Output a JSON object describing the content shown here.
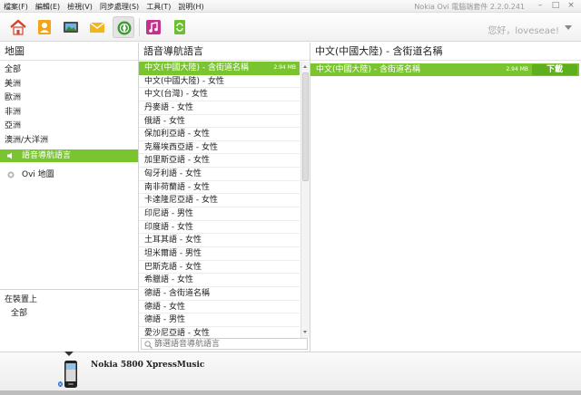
{
  "window": {
    "title": "Nokia Ovi 電腦端套件 2.2.0.241",
    "menus": [
      "檔案(F)",
      "編輯(E)",
      "檢視(V)",
      "同步處理(S)",
      "工具(T)",
      "說明(H)"
    ],
    "controls": [
      "–",
      "□",
      "×"
    ]
  },
  "toolbar": {
    "greeting": "您好，loveseae!",
    "buttons": [
      "home",
      "contacts",
      "photos",
      "messages",
      "maps",
      "music",
      "sync"
    ]
  },
  "left": {
    "header": "地圖",
    "regions": [
      "全部",
      "美洲",
      "歐洲",
      "非洲",
      "亞洲",
      "澳洲/大洋洲"
    ],
    "nav": [
      {
        "label": "語音導航語言",
        "selected": true
      },
      {
        "label": "Ovi 地圖",
        "selected": false
      }
    ],
    "device_section": {
      "header": "在裝置上",
      "item": "全部"
    }
  },
  "middle": {
    "header": "語音導航語言",
    "items": [
      {
        "label": "中文(中國大陸) - 含街道名稱",
        "size": "2.94 MB",
        "selected": true
      },
      {
        "label": "中文(中國大陸) - 女性"
      },
      {
        "label": "中文(台灣) - 女性"
      },
      {
        "label": "丹麥語 - 女性"
      },
      {
        "label": "俄語 - 女性"
      },
      {
        "label": "保加利亞語 - 女性"
      },
      {
        "label": "克羅埃西亞語 - 女性"
      },
      {
        "label": "加里斯亞語 - 女性"
      },
      {
        "label": "匈牙利語 - 女性"
      },
      {
        "label": "南非荷蘭語 - 女性"
      },
      {
        "label": "卡達隆尼亞語 - 女性"
      },
      {
        "label": "印尼語 - 男性"
      },
      {
        "label": "印度語 - 女性"
      },
      {
        "label": "土耳其語 - 女性"
      },
      {
        "label": "坦米爾語 - 男性"
      },
      {
        "label": "巴斯克語 - 女性"
      },
      {
        "label": "希臘語 - 女性"
      },
      {
        "label": "德語 - 含街道名稱"
      },
      {
        "label": "德語 - 女性"
      },
      {
        "label": "德語 - 男性"
      },
      {
        "label": "愛沙尼亞語 - 女性"
      }
    ],
    "search_placeholder": "篩選語音導航語言"
  },
  "right": {
    "header": "中文(中國大陸) - 含街道名稱",
    "item": {
      "label": "中文(中國大陸) - 含街道名稱",
      "size": "2.94 MB",
      "action": "下載"
    }
  },
  "device": {
    "name": "Nokia 5800 XpressMusic"
  },
  "colors": {
    "accent": "#7ac52f",
    "accent_dark": "#5fae1c"
  }
}
